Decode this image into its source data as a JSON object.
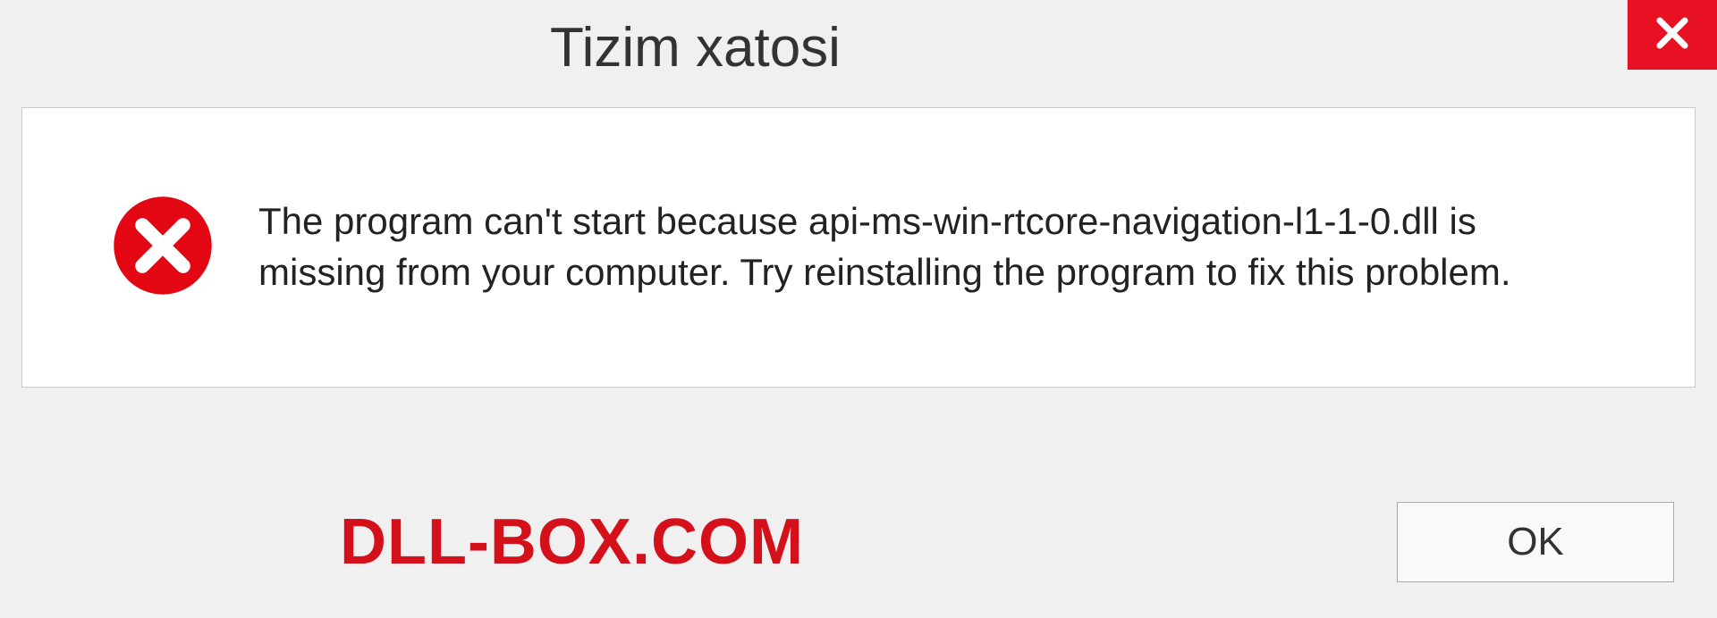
{
  "dialog": {
    "title": "Tizim xatosi",
    "message": "The program can't start because api-ms-win-rtcore-navigation-l1-1-0.dll is missing from your computer. Try reinstalling the program to fix this problem.",
    "ok_label": "OK",
    "watermark": "DLL-BOX.COM"
  }
}
